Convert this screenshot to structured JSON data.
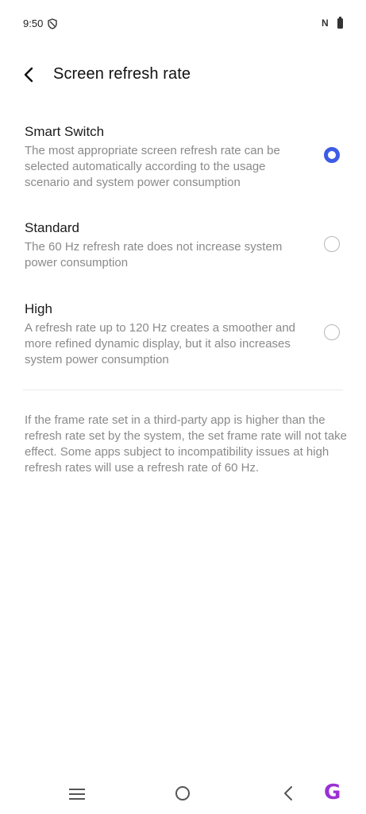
{
  "status_bar": {
    "time": "9:50",
    "nfc_glyph": "N",
    "icons": [
      "shield-icon",
      "nfc-icon",
      "battery-icon"
    ]
  },
  "header": {
    "title": "Screen refresh rate",
    "back_icon": "chevron-left-icon"
  },
  "options": [
    {
      "title": "Smart Switch",
      "description": "The most appropriate screen refresh rate can be selected automatically according to the usage scenario and system power consumption",
      "selected": true
    },
    {
      "title": "Standard",
      "description": "The 60 Hz refresh rate does not increase system power consumption",
      "selected": false
    },
    {
      "title": "High",
      "description": "A refresh rate up to 120 Hz creates a smoother and more refined dynamic display, but it also increases system power consumption",
      "selected": false
    }
  ],
  "footnote": "If the frame rate set in a third-party app is higher than the refresh rate set by the system, the set frame rate will not take effect. Some apps subject to incompatibility issues at high refresh rates will use a refresh rate of 60 Hz.",
  "nav_bar": {
    "icons": [
      "menu-icon",
      "home-icon",
      "back-icon"
    ],
    "watermark": "G"
  },
  "colors": {
    "accent": "#3d5ce5",
    "secondary_text": "#8a8a8a",
    "watermark": "#9b2fd4"
  }
}
